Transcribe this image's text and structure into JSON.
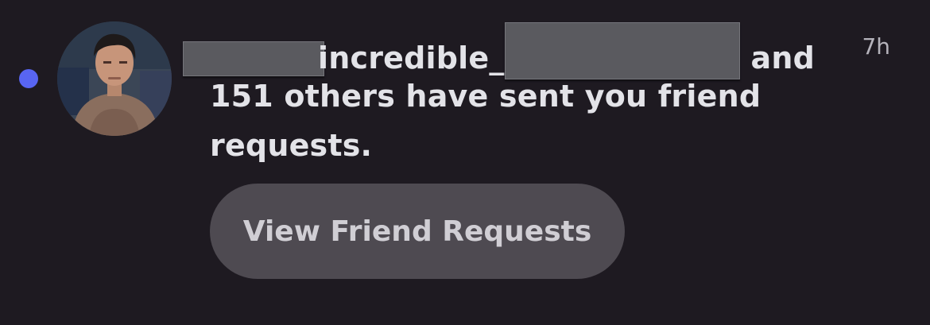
{
  "notification": {
    "line1_username": "incredible_",
    "line1_and": "and",
    "line2": "151 others have sent you friend",
    "line3": "requests.",
    "timestamp": "7h",
    "unread": true,
    "button_label": "View Friend Requests"
  },
  "colors": {
    "background": "#1e1a21",
    "unread_dot": "#5865f2",
    "button_bg": "#4e4a51",
    "text": "#e3e3e8",
    "timestamp": "#b5b3bb"
  },
  "icons": {
    "avatar": "user-avatar-photo"
  }
}
